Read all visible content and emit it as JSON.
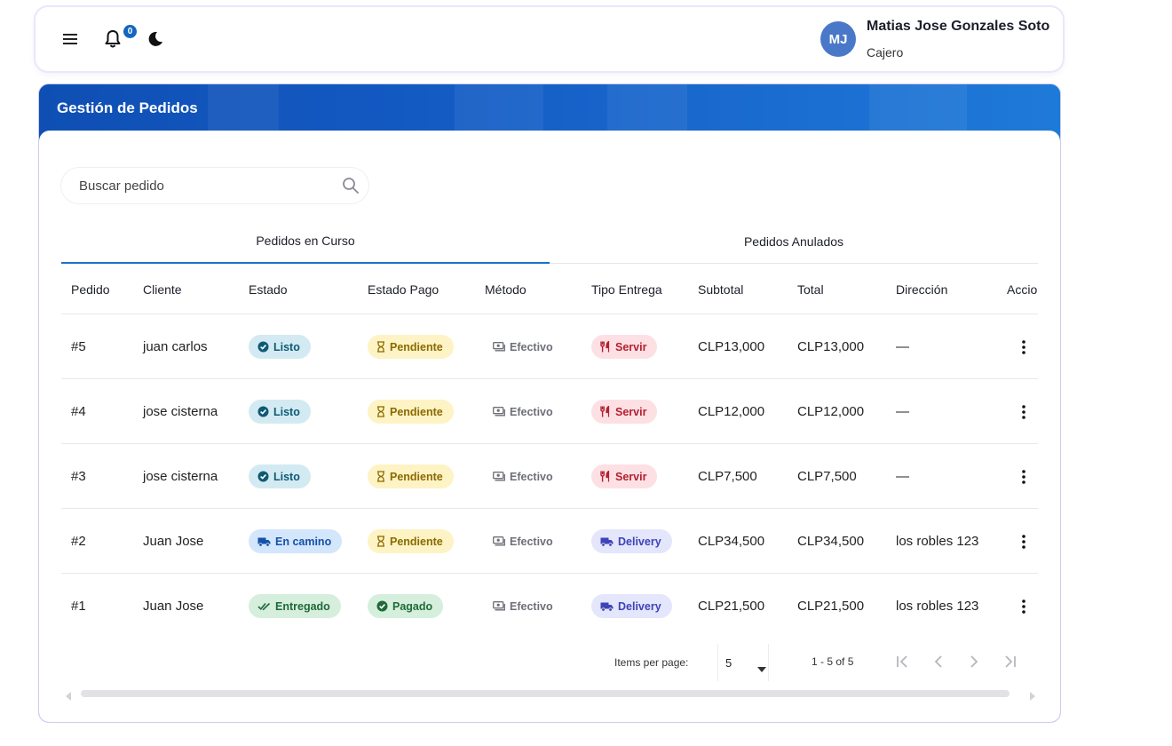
{
  "header": {
    "notification_count": "0",
    "user": {
      "initials": "MJ",
      "name": "Matias Jose Gonzales Soto",
      "role": "Cajero"
    }
  },
  "page": {
    "title": "Gestión de Pedidos",
    "search": {
      "placeholder": "Buscar pedido"
    },
    "tabs": [
      {
        "label": "Pedidos en Curso",
        "active": true
      },
      {
        "label": "Pedidos Anulados",
        "active": false
      }
    ]
  },
  "table": {
    "columns": [
      "Pedido",
      "Cliente",
      "Estado",
      "Estado Pago",
      "Método",
      "Tipo Entrega",
      "Subtotal",
      "Total",
      "Dirección",
      "Accio"
    ],
    "rows": [
      {
        "pedido": "#5",
        "cliente": "juan carlos",
        "estado": "Listo",
        "estado_pago": "Pendiente",
        "metodo": "Efectivo",
        "tipo_entrega": "Servir",
        "subtotal": "CLP13,000",
        "total": "CLP13,000",
        "direccion": "—"
      },
      {
        "pedido": "#4",
        "cliente": "jose cisterna",
        "estado": "Listo",
        "estado_pago": "Pendiente",
        "metodo": "Efectivo",
        "tipo_entrega": "Servir",
        "subtotal": "CLP12,000",
        "total": "CLP12,000",
        "direccion": "—"
      },
      {
        "pedido": "#3",
        "cliente": "jose cisterna",
        "estado": "Listo",
        "estado_pago": "Pendiente",
        "metodo": "Efectivo",
        "tipo_entrega": "Servir",
        "subtotal": "CLP7,500",
        "total": "CLP7,500",
        "direccion": "—"
      },
      {
        "pedido": "#2",
        "cliente": "Juan Jose",
        "estado": "En camino",
        "estado_pago": "Pendiente",
        "metodo": "Efectivo",
        "tipo_entrega": "Delivery",
        "subtotal": "CLP34,500",
        "total": "CLP34,500",
        "direccion": "los robles 123"
      },
      {
        "pedido": "#1",
        "cliente": "Juan Jose",
        "estado": "Entregado",
        "estado_pago": "Pagado",
        "metodo": "Efectivo",
        "tipo_entrega": "Delivery",
        "subtotal": "CLP21,500",
        "total": "CLP21,500",
        "direccion": "los robles 123"
      }
    ]
  },
  "paginator": {
    "items_per_page_label": "Items per page:",
    "page_size": "5",
    "range_label": "1 - 5 of 5"
  },
  "colors": {
    "primary": "#1565c0",
    "listo_bg": "#d3eaf2",
    "listo_fg": "#0e5a74",
    "en_camino_bg": "#d4e6fb",
    "en_camino_fg": "#1451a8",
    "entregado_bg": "#d5efdc",
    "entregado_fg": "#21683a",
    "pendiente_bg": "#fdf3c4",
    "pendiente_fg": "#8b6a00",
    "pagado_bg": "#d5efdc",
    "pagado_fg": "#1f6a38",
    "servir_bg": "#fde0e4",
    "servir_fg": "#b3202f",
    "delivery_bg": "#e4e6fb",
    "delivery_fg": "#3d43b8"
  }
}
